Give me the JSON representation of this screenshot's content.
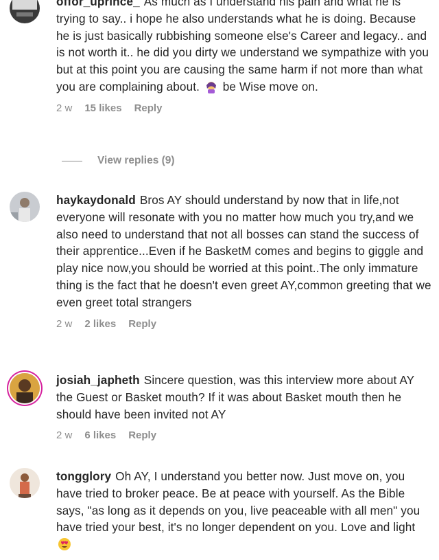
{
  "comments": [
    {
      "username": "offor_uprince_",
      "text_before_emoji": "As much as I understand his pain and what he is trying to say.. i hope he also understands what he is doing. Because he is just basically rubbishing someone else's Career and legacy.. and is not worth it.. he did you dirty we understand we sympathize with you but at this point you are causing the same harm if not more than what you are complaining about.",
      "emoji": "woman-facepalming-emoji",
      "text_after_emoji": "be Wise move on.",
      "time": "2 w",
      "likes": "15 likes",
      "reply": "Reply",
      "view_replies": "View replies (9)"
    },
    {
      "username": "haykaydonald",
      "text": "Bros AY should understand by now that in life,not everyone will resonate with you no matter how much you try,and we also need to understand that not all bosses can stand the success of their apprentice...Even if he BasketM comes and begins to giggle and play nice now,you should be worried at this point..The only immature thing is the fact that he doesn't even greet AY,common greeting that we even greet total strangers",
      "time": "2 w",
      "likes": "2 likes",
      "reply": "Reply"
    },
    {
      "username": "josiah_japheth",
      "text": "Sincere question, was this interview more about AY the Guest or Basket mouth? If it was about Basket mouth then he should have been invited not AY",
      "time": "2 w",
      "likes": "6 likes",
      "reply": "Reply"
    },
    {
      "username": "tongglory",
      "text": "Oh AY, I understand you better now. Just move on, you have tried to broker peace. Be at peace with yourself. As the Bible says, \"as long as it depends on you, live peaceable with all men\" you have tried your best, it's no longer dependent on you. Love and light",
      "emoji": "heart-eyes-emoji"
    }
  ],
  "colors": {
    "text": "#262626",
    "meta": "#8e8e8e",
    "story_ring": "#d6249f"
  }
}
